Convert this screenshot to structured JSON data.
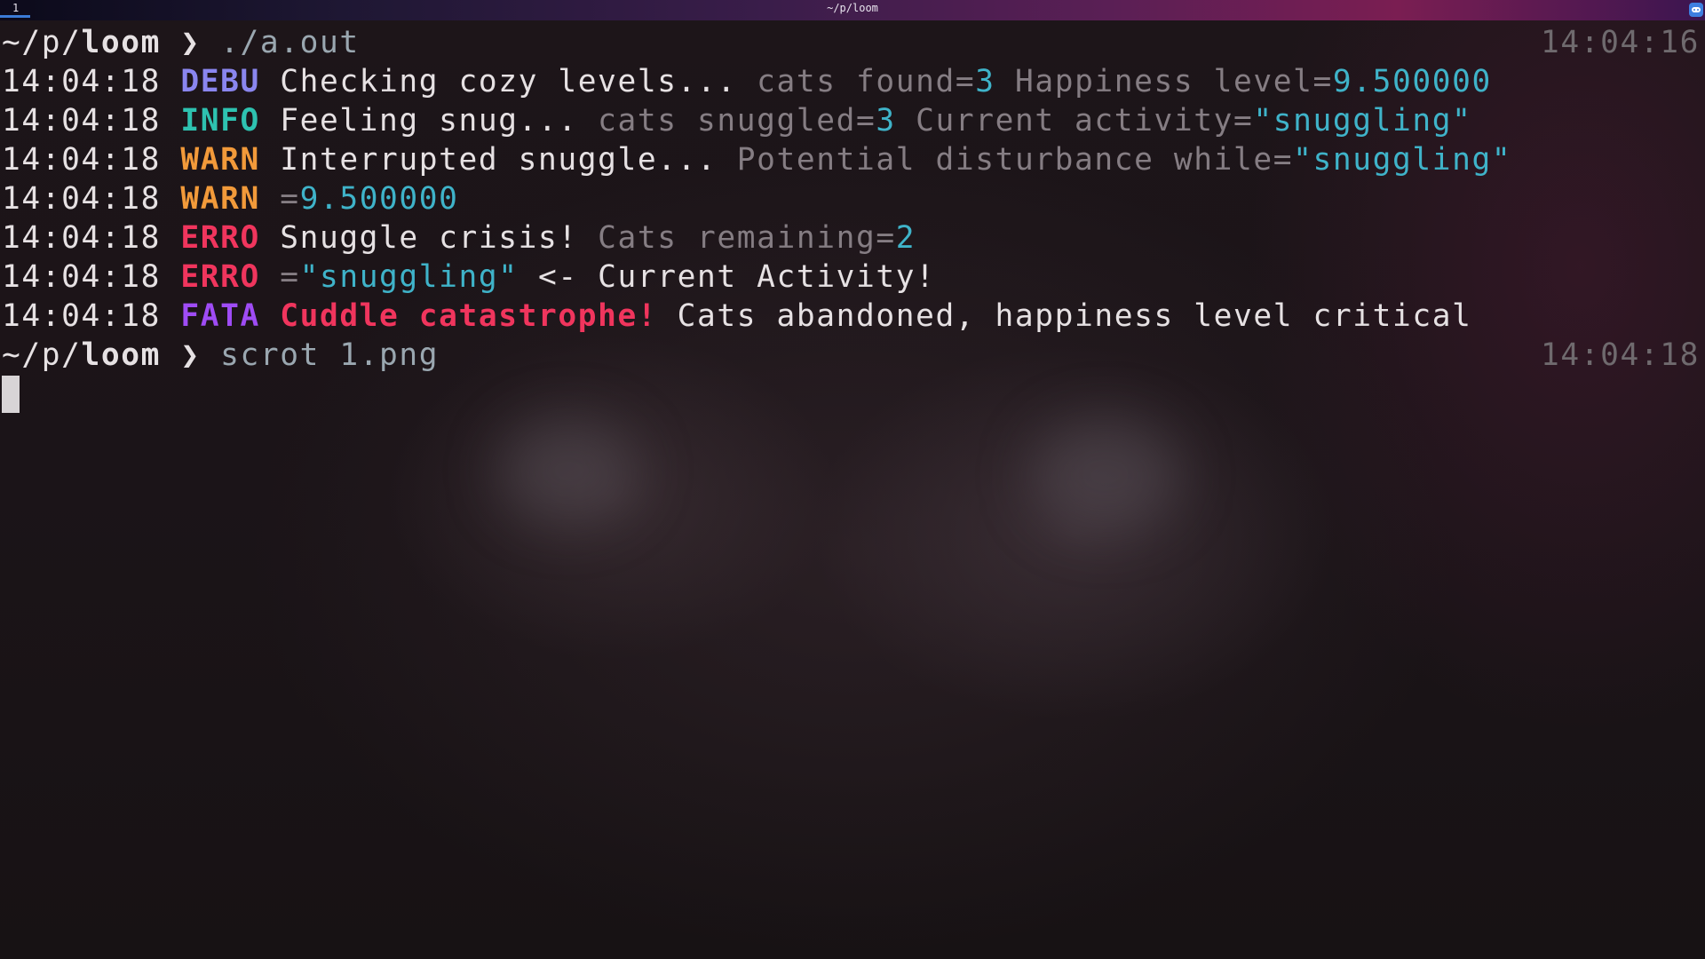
{
  "topbar": {
    "workspace": "1",
    "window_title": "~/p/loom",
    "tray_icon": "discord-icon"
  },
  "prompt1": {
    "path_prefix": "~/p/",
    "dir": "loom",
    "arrow": "❯",
    "command": "./a.out",
    "time": "14:04:16"
  },
  "log": [
    {
      "time": "14:04:18",
      "level": "DEBU",
      "message": "Checking cozy levels...",
      "k1": "cats found=",
      "v1": "3",
      "k2": "Happiness level=",
      "v2": "9.500000"
    },
    {
      "time": "14:04:18",
      "level": "INFO",
      "message": "Feeling snug...",
      "k1": "cats snuggled=",
      "v1": "3",
      "k2": "Current activity=",
      "v2": "\"snuggling\""
    },
    {
      "time": "14:04:18",
      "level": "WARN",
      "message": "Interrupted snuggle...",
      "k1": "Potential disturbance while=",
      "v1": "\"snuggling\""
    },
    {
      "time": "14:04:18",
      "level": "WARN",
      "k1": "=",
      "v1": "9.500000"
    },
    {
      "time": "14:04:18",
      "level": "ERRO",
      "message": "Snuggle crisis!",
      "k1": "Cats remaining=",
      "v1": "2"
    },
    {
      "time": "14:04:18",
      "level": "ERRO",
      "k1": "=",
      "v1": "\"snuggling\"",
      "rest": "<- Current Activity!"
    },
    {
      "time": "14:04:18",
      "level": "FATA",
      "message": "Cuddle catastrophe!",
      "rest": "Cats abandoned, happiness level critical"
    }
  ],
  "prompt2": {
    "path_prefix": "~/p/",
    "dir": "loom",
    "arrow": "❯",
    "command": "scrot 1.png",
    "time": "14:04:18"
  },
  "colors": {
    "debu": "#8a86ef",
    "info": "#2ec2b0",
    "warn": "#f29a3a",
    "erro": "#f0355d",
    "fata": "#9f4cf5",
    "value": "#3fb3c9"
  }
}
